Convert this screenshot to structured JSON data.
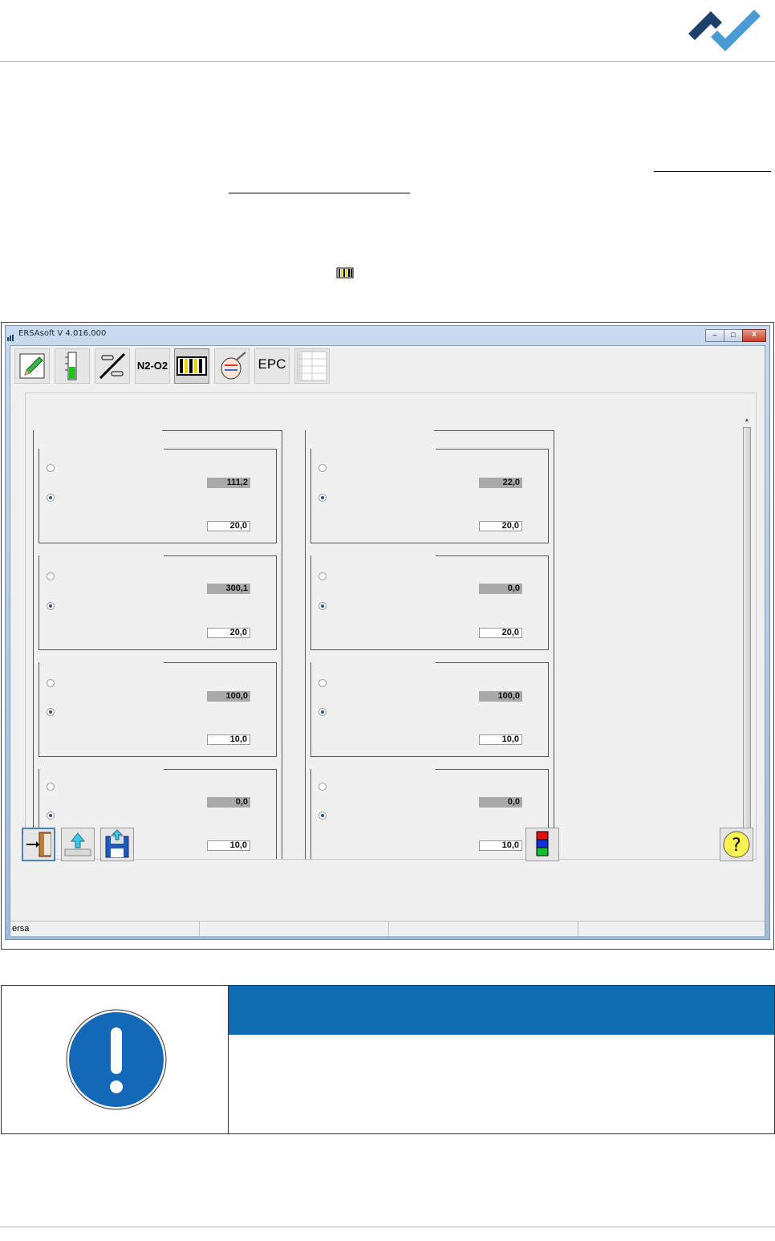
{
  "window": {
    "title": "ERSAsoft V 4.016.000",
    "controls": {
      "minimize": "–",
      "maximize": "□",
      "close": "x"
    }
  },
  "toolbar": {
    "items": [
      {
        "name": "edit-pencil",
        "label": ""
      },
      {
        "name": "heater-level",
        "label": ""
      },
      {
        "name": "conveyor-transport",
        "label": ""
      },
      {
        "name": "n2-o2",
        "label": "N2-O2"
      },
      {
        "name": "heating-zones",
        "label": ""
      },
      {
        "name": "thermo-sensor",
        "label": ""
      },
      {
        "name": "epc",
        "label": "EPC"
      },
      {
        "name": "table",
        "label": ""
      }
    ]
  },
  "columns": [
    {
      "groups": [
        {
          "value": "111,2",
          "input": "20,0"
        },
        {
          "value": "300,1",
          "input": "20,0"
        },
        {
          "value": "100,0",
          "input": "10,0"
        },
        {
          "value": "0,0",
          "input": "10,0"
        }
      ]
    },
    {
      "groups": [
        {
          "value": "22,0",
          "input": "20,0"
        },
        {
          "value": "0,0",
          "input": "20,0"
        },
        {
          "value": "100,0",
          "input": "10,0"
        },
        {
          "value": "0,0",
          "input": "10,0"
        }
      ]
    }
  ],
  "statusbar": {
    "user": "ersa"
  },
  "notice": {
    "header": "",
    "body": ""
  },
  "colors": {
    "brand_dark": "#1f3f6b",
    "brand_light": "#4a9ad6",
    "notice_blue": "#0e6cb0",
    "link_underline": "#000000"
  }
}
